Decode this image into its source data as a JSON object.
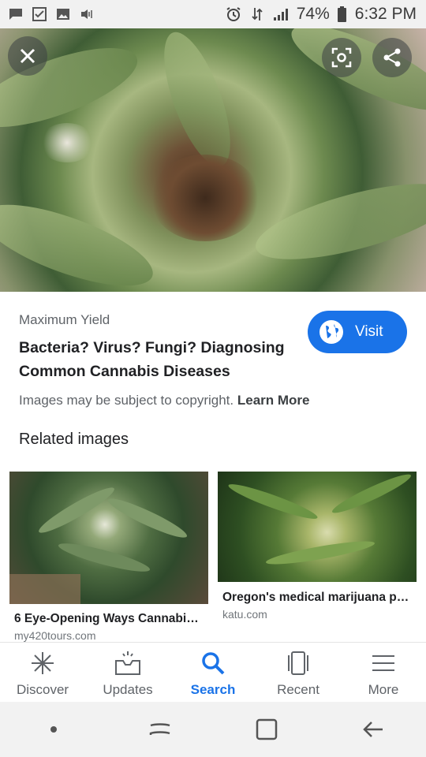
{
  "status_bar": {
    "battery": "74%",
    "time": "6:32 PM"
  },
  "result": {
    "source": "Maximum Yield",
    "title": "Bacteria? Virus? Fungi? Diagnosing Common Cannabis Diseases",
    "visit_label": "Visit",
    "copyright_text": "Images may be subject to copyright.",
    "learn_more": "Learn More"
  },
  "related": {
    "heading": "Related images",
    "items": [
      {
        "title": "6 Eye-Opening Ways Cannabi…",
        "domain": "my420tours.com"
      },
      {
        "title": "Oregon's medical marijuana p…",
        "domain": "katu.com"
      }
    ]
  },
  "nav": {
    "items": [
      {
        "label": "Discover",
        "icon": "asterisk-icon"
      },
      {
        "label": "Updates",
        "icon": "inbox-icon"
      },
      {
        "label": "Search",
        "icon": "search-icon"
      },
      {
        "label": "Recent",
        "icon": "recent-cards-icon"
      },
      {
        "label": "More",
        "icon": "hamburger-icon"
      }
    ]
  },
  "colors": {
    "accent": "#1a73e8",
    "text_primary": "#202124",
    "text_secondary": "#5f6368"
  }
}
